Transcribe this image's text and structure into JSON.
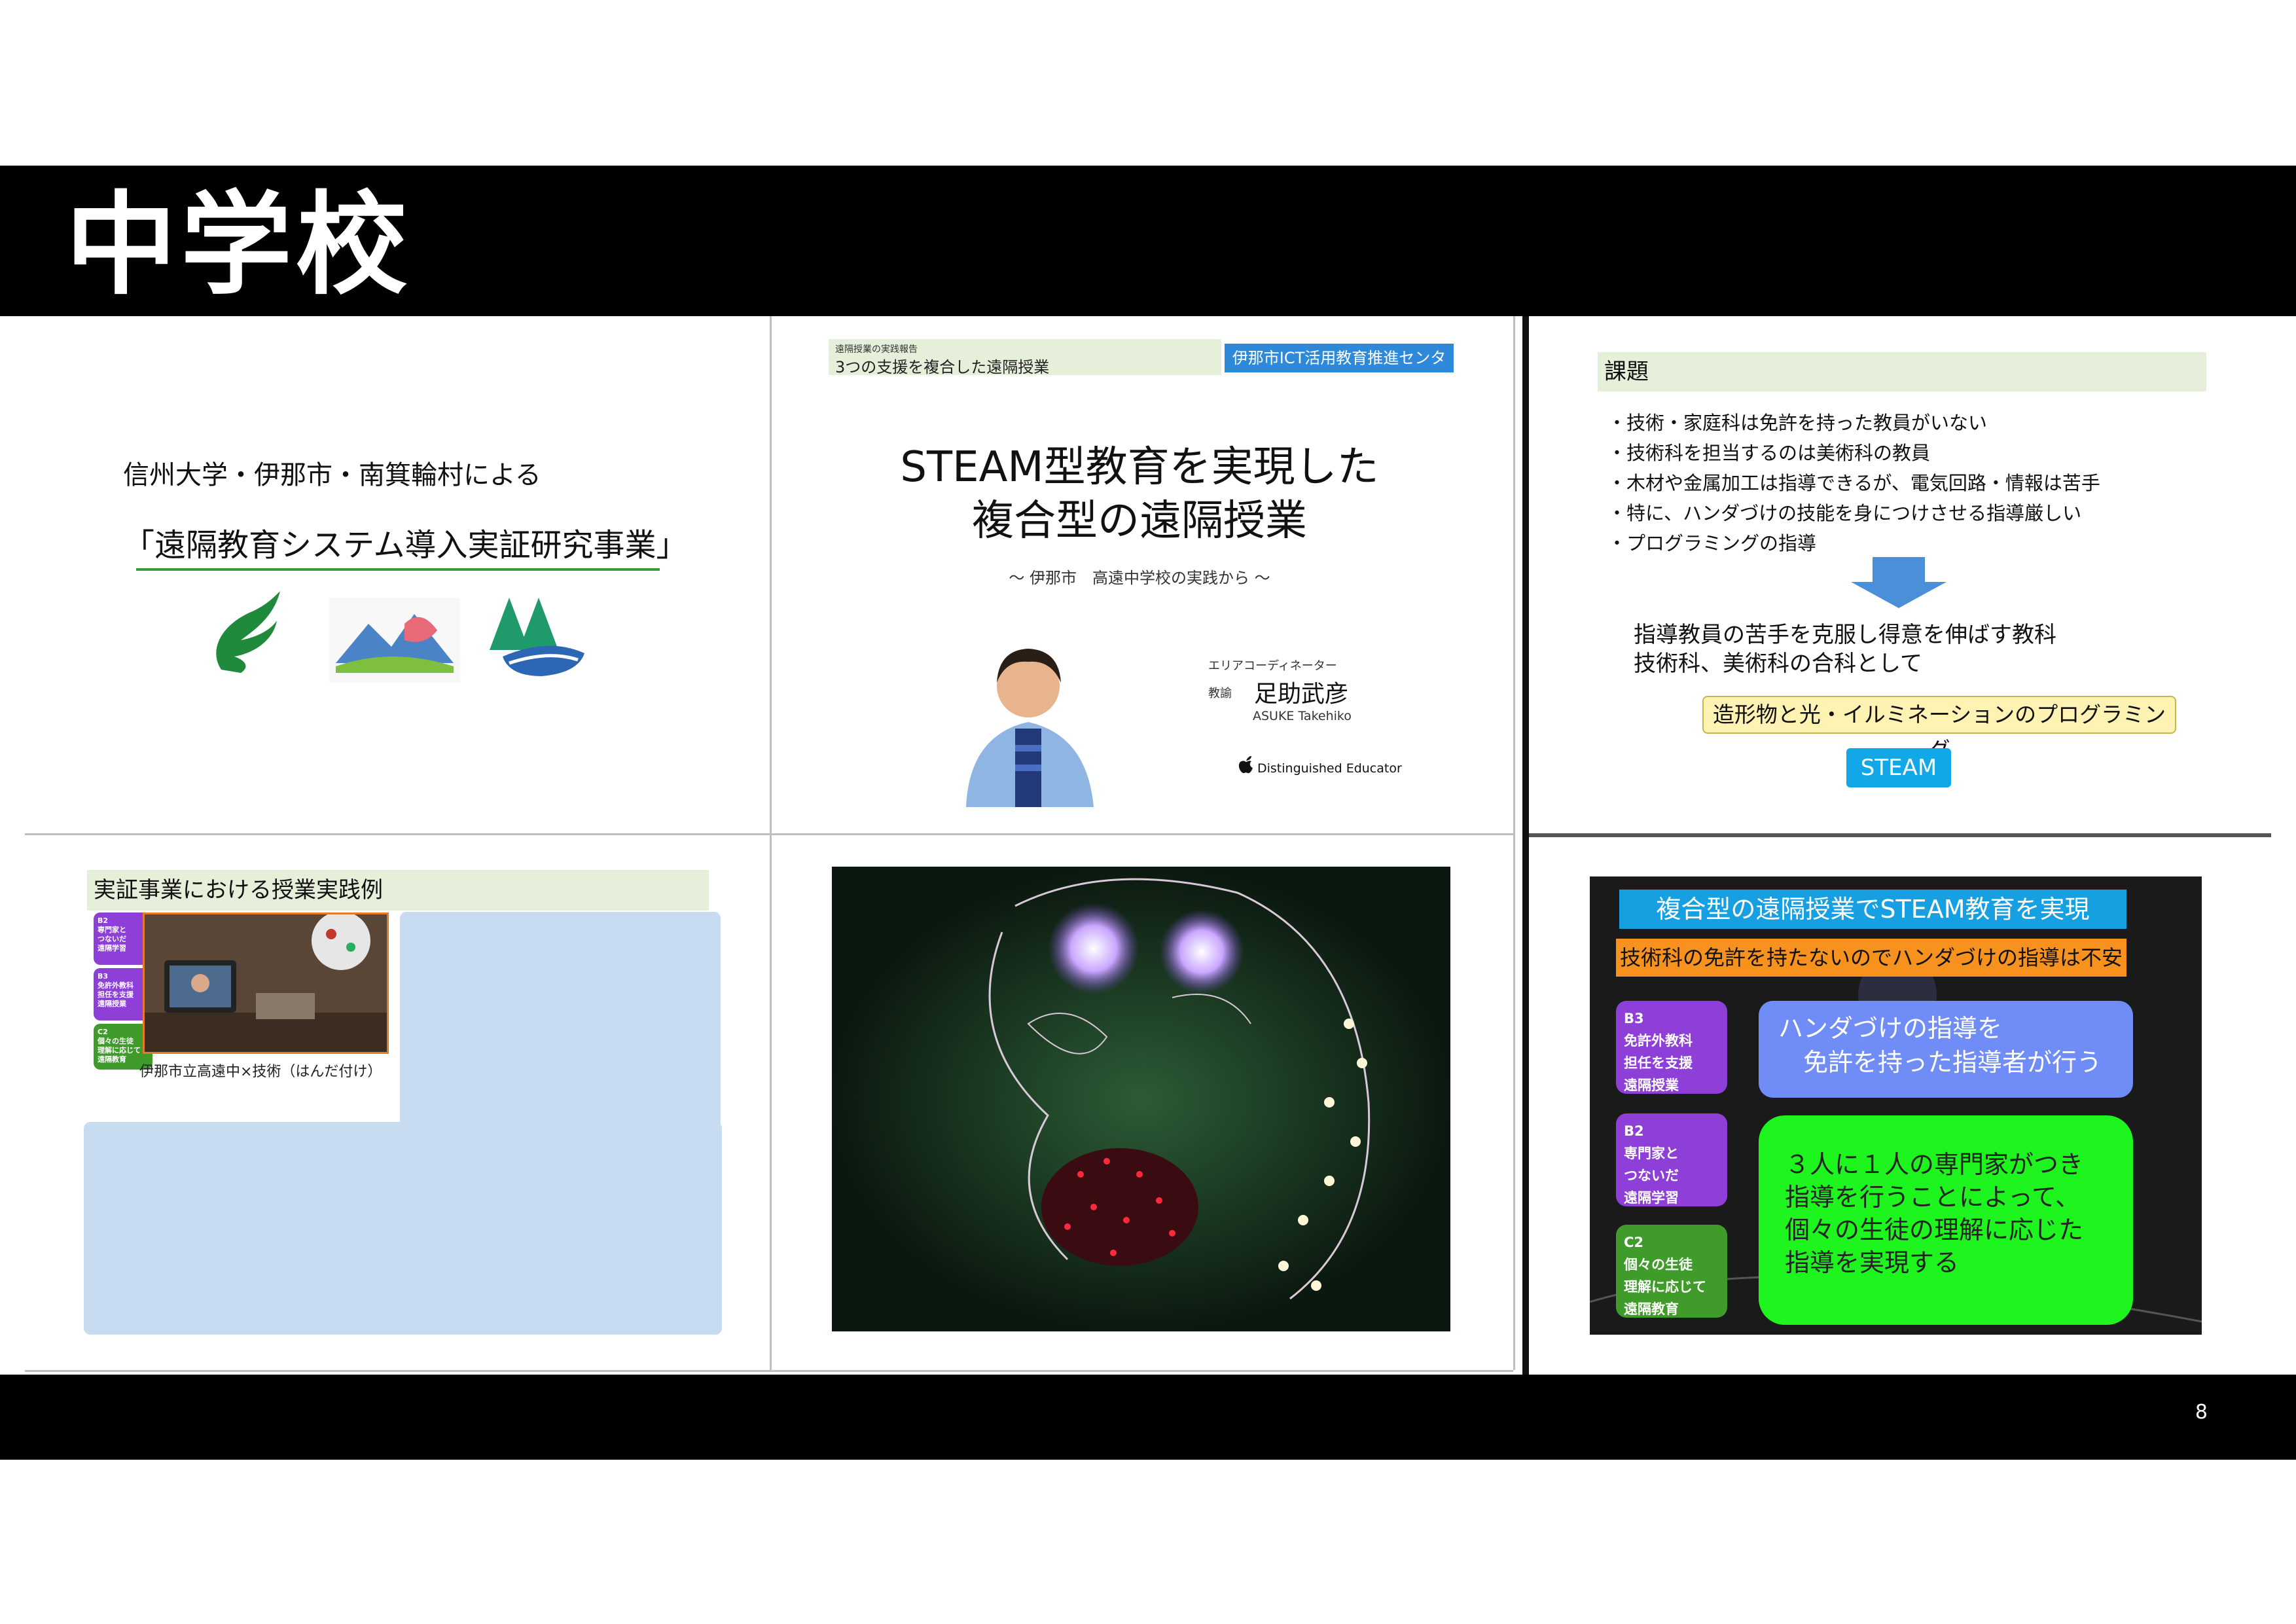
{
  "page": {
    "title": "中学校",
    "page_number": "8"
  },
  "slide1": {
    "subtitle": "信州大学・伊那市・南箕輪村による",
    "title": "「遠隔教育システム導入実証研究事業」"
  },
  "slide2": {
    "band_small": "遠隔授業の実践報告",
    "band_main": "3つの支援を複合した遠隔授業",
    "badge": "伊那市ICT活用教育推進センター",
    "title_line1": "STEAM型教育を実現した",
    "title_line2": "複合型の遠隔授業",
    "subtitle": "～ 伊那市　高遠中学校の実践から ～",
    "role": "エリアコーディネーター",
    "title_label": "教諭",
    "name": "足助武彦",
    "name_roman": "ASUKE Takehiko",
    "program": "Distinguished Educator"
  },
  "slide3": {
    "heading": "課題",
    "items": [
      "技術・家庭科は免許を持った教員がいない",
      "技術科を担当するのは美術科の教員",
      "木材や金属加工は指導できるが、電気回路・情報は苦手",
      "特に、ハンダづけの技能を身につけさせる指導厳しい",
      "プログラミングの指導"
    ],
    "text_line1": "指導教員の苦手を克服し得意を伸ばす教科",
    "text_line2": "技術科、美術科の合科として",
    "highlight": "造形物と光・イルミネーションのプログラミング",
    "steam": "STEAM"
  },
  "slide4": {
    "heading": "実証事業における授業実践例",
    "tags": [
      {
        "code": "B2",
        "text": "専門家と\nつないだ\n遠隔学習",
        "color": "purple"
      },
      {
        "code": "B3",
        "text": "免許外教科\n担任を支援\n遠隔授業",
        "color": "purple"
      },
      {
        "code": "C2",
        "text": "個々の生徒\n理解に応じて\n遠隔教育",
        "color": "green"
      }
    ],
    "caption": "伊那市立高遠中×技術（はんだ付け）"
  },
  "slide6": {
    "heading": "複合型の遠隔授業でSTEAM教育を実現",
    "orange": "技術科の免許を持たないのでハンダづけの指導は不安",
    "tags": [
      {
        "code": "B3",
        "text": "免許外教科\n担任を支援\n遠隔授業",
        "color": "purple"
      },
      {
        "code": "B2",
        "text": "専門家と\nつないだ\n遠隔学習",
        "color": "purple"
      },
      {
        "code": "C2",
        "text": "個々の生徒\n理解に応じて\n遠隔教育",
        "color": "green"
      }
    ],
    "blue_line1": "ハンダづけの指導を",
    "blue_line2": "　免許を持った指導者が行う",
    "green_lines": [
      "３人に１人の専門家がつき",
      "指導を行うことによって、",
      "個々の生徒の理解に応じた",
      "指導を実現する"
    ]
  },
  "colors": {
    "band": "#000000",
    "accent_blue": "#17a0e1",
    "accent_orange": "#f7921e",
    "accent_green": "#1ef51e",
    "purple_tag": "#8e3fd8",
    "green_tag": "#3f9c2a"
  }
}
